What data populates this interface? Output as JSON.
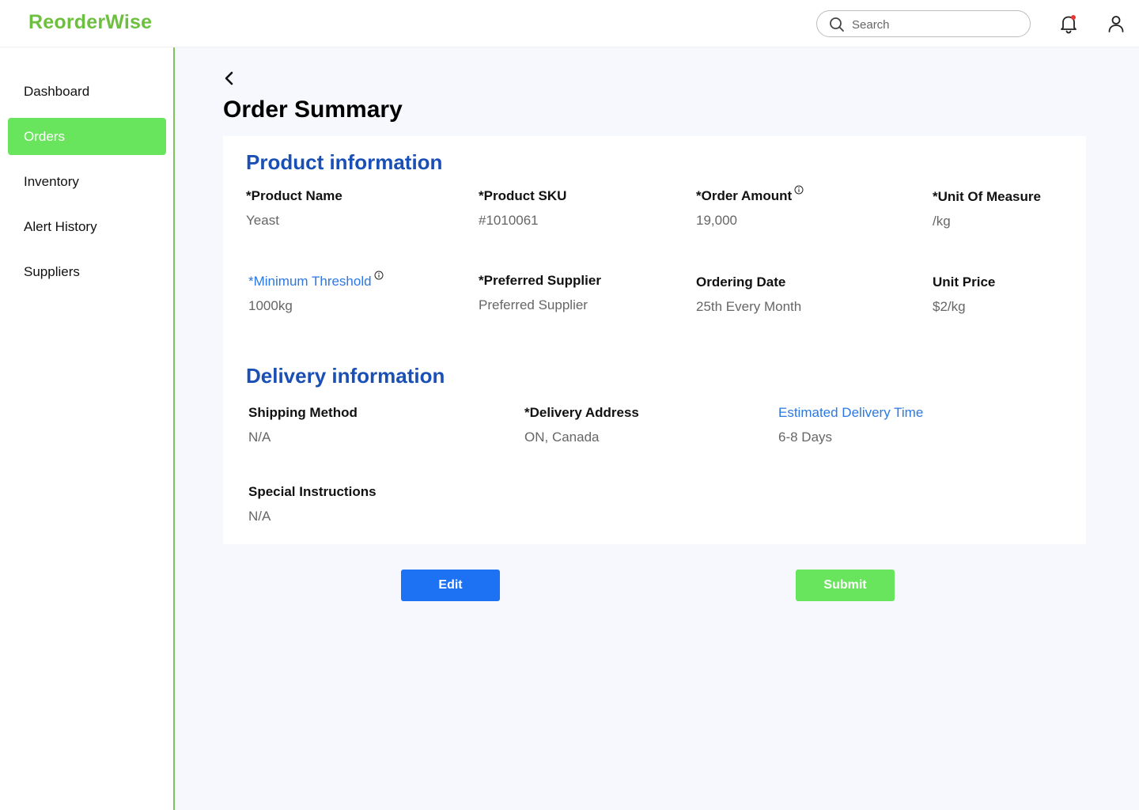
{
  "app": {
    "logo": "ReorderWise"
  },
  "header": {
    "search_placeholder": "Search"
  },
  "sidebar": {
    "items": [
      {
        "label": "Dashboard",
        "active": false
      },
      {
        "label": "Orders",
        "active": true
      },
      {
        "label": "Inventory",
        "active": false
      },
      {
        "label": "Alert History",
        "active": false
      },
      {
        "label": "Suppliers",
        "active": false
      }
    ]
  },
  "page": {
    "title": "Order Summary"
  },
  "product": {
    "title": "Product information",
    "fields": [
      {
        "label": "*Product Name",
        "value": "Yeast"
      },
      {
        "label": "*Product SKU",
        "value": "#1010061"
      },
      {
        "label": "*Order Amount",
        "value": "19,000"
      },
      {
        "label": "*Unit Of Measure",
        "value": "/kg"
      },
      {
        "label": "*Minimum Threshold",
        "value": "1000kg"
      },
      {
        "label": "*Preferred Supplier",
        "value": "Preferred Supplier"
      },
      {
        "label": "Ordering Date",
        "value": "25th Every Month"
      },
      {
        "label": "Unit Price",
        "value": "$2/kg"
      }
    ]
  },
  "delivery": {
    "title": "Delivery information",
    "fields": [
      {
        "label": "Shipping Method",
        "value": "N/A"
      },
      {
        "label": "*Delivery Address",
        "value": "ON, Canada"
      },
      {
        "label": "Estimated Delivery Time",
        "value": "6-8 Days"
      },
      {
        "label": "Special Instructions",
        "value": "N/A"
      }
    ]
  },
  "actions": {
    "edit": "Edit",
    "submit": "Submit"
  },
  "colors": {
    "brand": "#6cbf3f",
    "active_nav": "#69e55d",
    "section_title": "#1a4fb5",
    "link_label": "#2b78e4",
    "edit_button": "#1d72f3",
    "notification_dot": "#e53935"
  }
}
